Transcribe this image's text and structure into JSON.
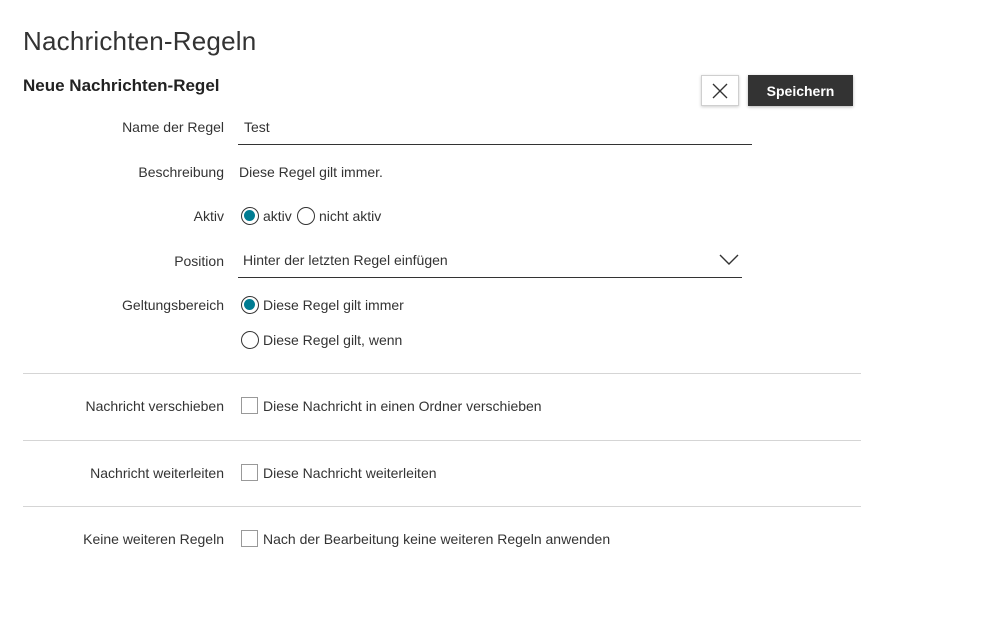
{
  "page": {
    "title": "Nachrichten-Regeln",
    "section_title": "Neue Nachrichten-Regel"
  },
  "toolbar": {
    "close_icon": "close-icon",
    "save_label": "Speichern"
  },
  "form": {
    "name": {
      "label": "Name der Regel",
      "value": "Test"
    },
    "description": {
      "label": "Beschreibung",
      "value": "Diese Regel gilt immer."
    },
    "active": {
      "label": "Aktiv",
      "options": [
        {
          "label": "aktiv",
          "checked": true
        },
        {
          "label": "nicht aktiv",
          "checked": false
        }
      ]
    },
    "position": {
      "label": "Position",
      "selected": "Hinter der letzten Regel einfügen",
      "icon": "chevron-down-icon"
    },
    "scope": {
      "label": "Geltungsbereich",
      "options": [
        {
          "label": "Diese Regel gilt immer",
          "checked": true
        },
        {
          "label": "Diese Regel gilt, wenn",
          "checked": false
        }
      ]
    }
  },
  "actions": [
    {
      "label": "Nachricht verschieben",
      "checkbox_label": "Diese Nachricht in einen Ordner verschieben",
      "checked": false
    },
    {
      "label": "Nachricht weiterleiten",
      "checkbox_label": "Diese Nachricht weiterleiten",
      "checked": false
    },
    {
      "label": "Keine weiteren Regeln",
      "checkbox_label": "Nach der Bearbeitung keine weiteren Regeln anwenden",
      "checked": false
    }
  ],
  "colors": {
    "accent": "#007c92",
    "button_dark": "#333333",
    "divider": "#d5d5d5"
  }
}
